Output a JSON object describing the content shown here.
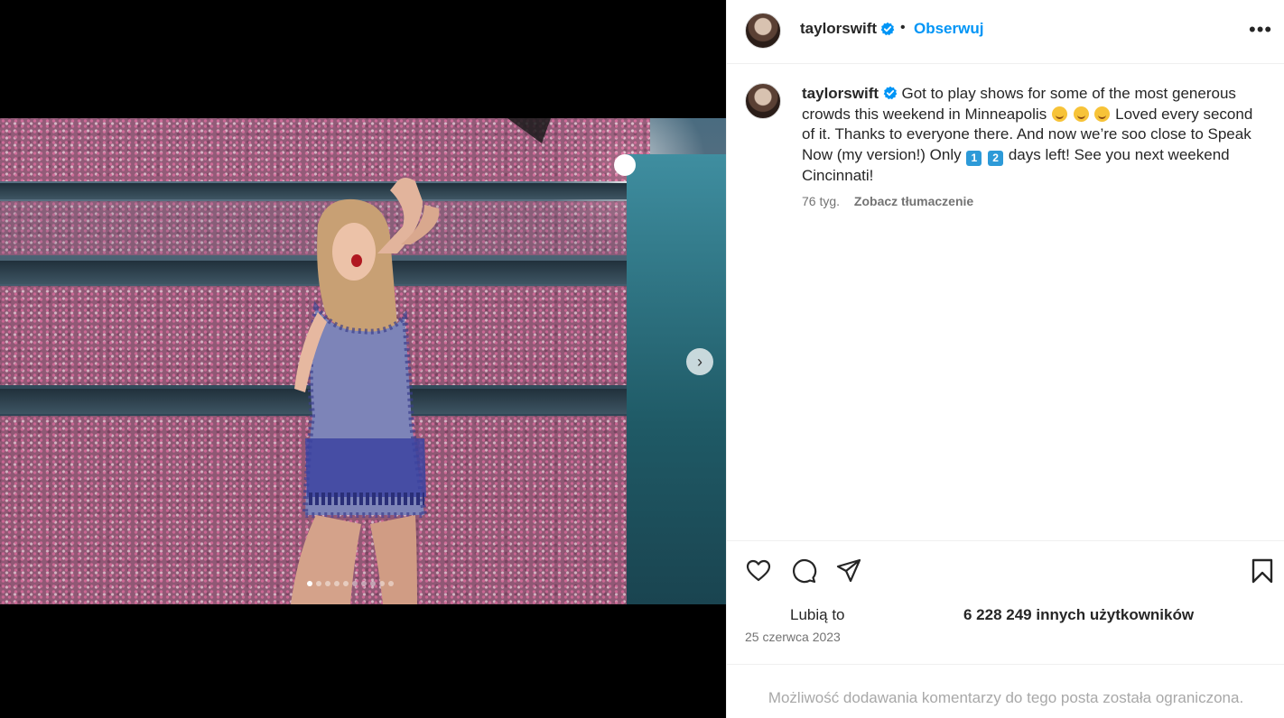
{
  "post": {
    "author": "taylorswift",
    "follow_label": "Obserwuj",
    "separator": "•",
    "more_label": "•••",
    "caption": {
      "author": "taylorswift",
      "part1": " Got to play shows for some of the most generous crowds this weekend in Minneapolis ",
      "part2": " Loved every second of it. Thanks to everyone there. And now we’re soo close to Speak Now (my version!) Only ",
      "keycap1": "1",
      "keycap2": "2",
      "part3": " days left! See you next weekend Cincinnati!"
    },
    "time_ago": "76 tyg.",
    "translate_label": "Zobacz tłumaczenie",
    "likes_label": "Lubią to",
    "likes_count": "6 228 249 innych użytkowników",
    "date": "25 czerwca 2023",
    "comments_limited": "Możliwość dodawania komentarzy do tego posta została ograniczona."
  },
  "media": {
    "next_arrow": "›",
    "carousel_dots": 10,
    "active_dot": 0
  },
  "icons": {
    "verified": "verified-badge-icon",
    "like": "heart-icon",
    "comment": "comment-icon",
    "share": "paper-plane-icon",
    "save": "bookmark-icon",
    "more": "more-options-icon",
    "next": "chevron-right-icon"
  },
  "colors": {
    "accent": "#0095f6",
    "muted": "#737373",
    "text": "#262626"
  }
}
